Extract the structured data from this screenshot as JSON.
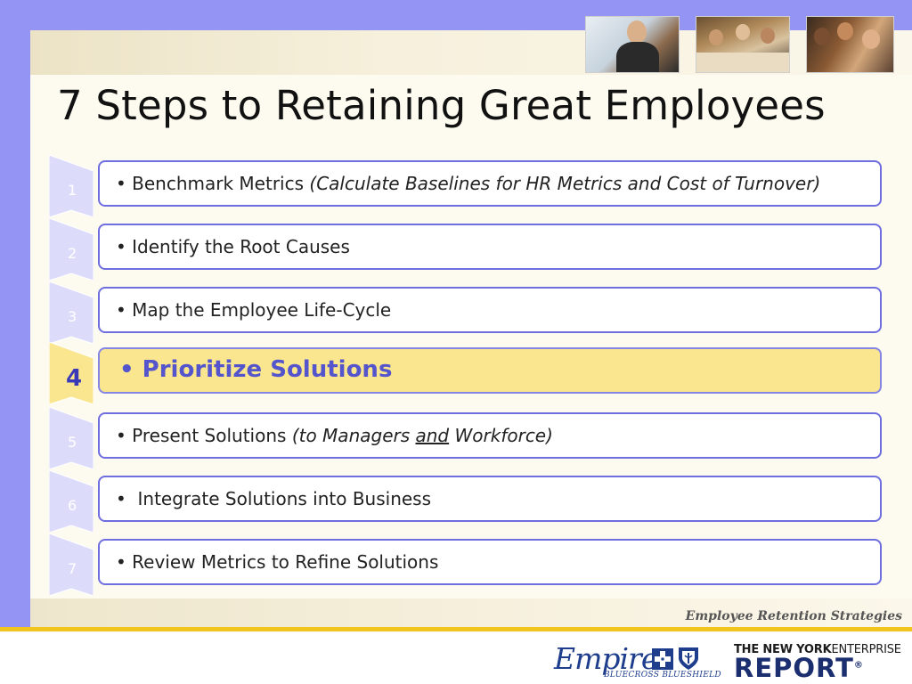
{
  "slide": {
    "title": "7 Steps to Retaining Great Employees",
    "steps": [
      {
        "number": "1",
        "bullet": "• Benchmark Metrics ",
        "detail": "(Calculate Baselines for HR Metrics and Cost of Turnover)",
        "active": false
      },
      {
        "number": "2",
        "bullet": "• Identify the Root Causes",
        "active": false
      },
      {
        "number": "3",
        "bullet": "• Map the Employee Life-Cycle",
        "active": false
      },
      {
        "number": "4",
        "bullet": "• Prioritize Solutions",
        "active": true
      },
      {
        "number": "5",
        "bullet": "• Present Solutions ",
        "detail_pre": "(to Managers ",
        "detail_ul": "and",
        "detail_post": " Workforce)",
        "active": false
      },
      {
        "number": "6",
        "bullet": "•  Integrate Solutions into Business",
        "active": false
      },
      {
        "number": "7",
        "bullet": "• Review Metrics to Refine Solutions",
        "active": false
      }
    ],
    "footer_caption": "Employee Retention Strategies"
  },
  "logos": {
    "empire": {
      "name": "Empire",
      "sub": "BLUECROSS BLUESHIELD"
    },
    "report": {
      "top_bold": "THE NEW YORK",
      "top_rest": "ENTERPRISE",
      "word": "REPORT",
      "mark": "®"
    }
  },
  "colors": {
    "frame_purple": "#9494f4",
    "box_border": "#6e6ee0",
    "active_fill": "#fbe690",
    "active_text": "#5454cc",
    "gold_rule": "#f2c41e",
    "brand_blue": "#1e3d8c"
  }
}
